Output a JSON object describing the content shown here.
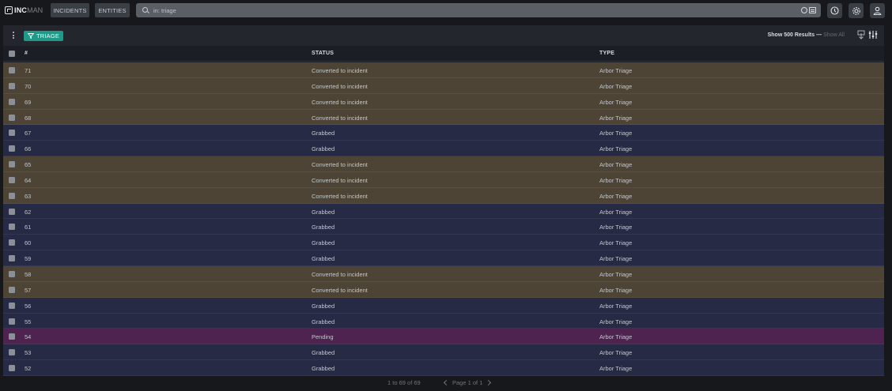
{
  "brand": {
    "inc": "INC",
    "man": "MAN"
  },
  "nav": {
    "incidents": "INCIDENTS",
    "entities": "ENTITIES"
  },
  "search": {
    "value": "in: triage"
  },
  "toolbar": {
    "badge": "TRIAGE",
    "results_label": "Show 500 Results",
    "dash": "—",
    "show_all": "Show All"
  },
  "table": {
    "columns": [
      "#",
      "STATUS",
      "TYPE"
    ],
    "rows": [
      {
        "id": "71",
        "status": "Converted to incident",
        "type": "Arbor Triage"
      },
      {
        "id": "70",
        "status": "Converted to incident",
        "type": "Arbor Triage"
      },
      {
        "id": "69",
        "status": "Converted to incident",
        "type": "Arbor Triage"
      },
      {
        "id": "68",
        "status": "Converted to incident",
        "type": "Arbor Triage"
      },
      {
        "id": "67",
        "status": "Grabbed",
        "type": "Arbor Triage"
      },
      {
        "id": "66",
        "status": "Grabbed",
        "type": "Arbor Triage"
      },
      {
        "id": "65",
        "status": "Converted to incident",
        "type": "Arbor Triage"
      },
      {
        "id": "64",
        "status": "Converted to incident",
        "type": "Arbor Triage"
      },
      {
        "id": "63",
        "status": "Converted to incident",
        "type": "Arbor Triage"
      },
      {
        "id": "62",
        "status": "Grabbed",
        "type": "Arbor Triage"
      },
      {
        "id": "61",
        "status": "Grabbed",
        "type": "Arbor Triage"
      },
      {
        "id": "60",
        "status": "Grabbed",
        "type": "Arbor Triage"
      },
      {
        "id": "59",
        "status": "Grabbed",
        "type": "Arbor Triage"
      },
      {
        "id": "58",
        "status": "Converted to incident",
        "type": "Arbor Triage"
      },
      {
        "id": "57",
        "status": "Converted to incident",
        "type": "Arbor Triage"
      },
      {
        "id": "56",
        "status": "Grabbed",
        "type": "Arbor Triage"
      },
      {
        "id": "55",
        "status": "Grabbed",
        "type": "Arbor Triage"
      },
      {
        "id": "54",
        "status": "Pending",
        "type": "Arbor Triage"
      },
      {
        "id": "53",
        "status": "Grabbed",
        "type": "Arbor Triage"
      },
      {
        "id": "52",
        "status": "Grabbed",
        "type": "Arbor Triage"
      }
    ]
  },
  "footer": {
    "count": "1 to 69 of 69",
    "page": "Page 1 of 1"
  },
  "colors": {
    "converted_row": "#4d4435",
    "grabbed_row": "#262a44",
    "pending_row": "#4e2350",
    "badge": "#1f9a88"
  },
  "icons": [
    "search-icon",
    "help-icon",
    "settings-icon",
    "user-icon",
    "export-icon",
    "column-settings-icon",
    "kebab-menu-icon",
    "triage-icon"
  ]
}
